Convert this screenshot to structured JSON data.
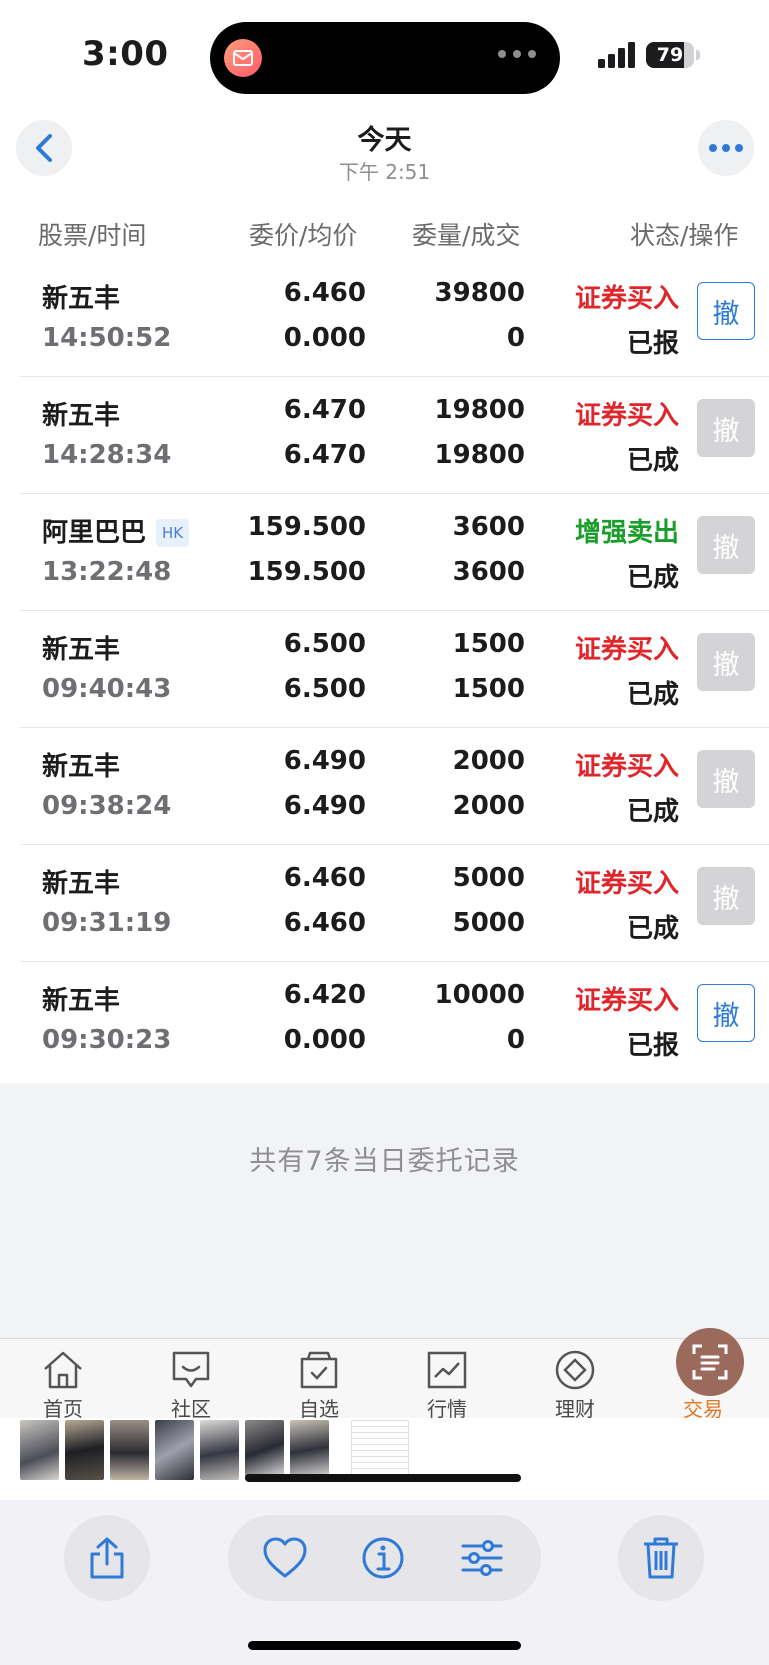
{
  "status_bar": {
    "time": "3:00",
    "battery": "79",
    "battery_level": 0.79
  },
  "nav": {
    "title": "今天",
    "subtitle": "下午 2:51",
    "back_icon": "chevron-left-icon",
    "more_icon": "ellipsis-icon"
  },
  "columns": {
    "stock_time": "股票/时间",
    "price_avg": "委价/均价",
    "qty_filled": "委量/成交",
    "status_action": "状态/操作"
  },
  "orders": [
    {
      "name": "新五丰",
      "tag": "",
      "time": "14:50:52",
      "price": "6.460",
      "avg": "0.000",
      "qty": "39800",
      "filled": "0",
      "action": "证券买入",
      "action_color": "red",
      "state": "已报",
      "cancel": "撤",
      "cancelable": true
    },
    {
      "name": "新五丰",
      "tag": "",
      "time": "14:28:34",
      "price": "6.470",
      "avg": "6.470",
      "qty": "19800",
      "filled": "19800",
      "action": "证券买入",
      "action_color": "red",
      "state": "已成",
      "cancel": "撤",
      "cancelable": false
    },
    {
      "name": "阿里巴巴",
      "tag": "HK",
      "time": "13:22:48",
      "price": "159.500",
      "avg": "159.500",
      "qty": "3600",
      "filled": "3600",
      "action": "增强卖出",
      "action_color": "green",
      "state": "已成",
      "cancel": "撤",
      "cancelable": false
    },
    {
      "name": "新五丰",
      "tag": "",
      "time": "09:40:43",
      "price": "6.500",
      "avg": "6.500",
      "qty": "1500",
      "filled": "1500",
      "action": "证券买入",
      "action_color": "red",
      "state": "已成",
      "cancel": "撤",
      "cancelable": false
    },
    {
      "name": "新五丰",
      "tag": "",
      "time": "09:38:24",
      "price": "6.490",
      "avg": "6.490",
      "qty": "2000",
      "filled": "2000",
      "action": "证券买入",
      "action_color": "red",
      "state": "已成",
      "cancel": "撤",
      "cancelable": false
    },
    {
      "name": "新五丰",
      "tag": "",
      "time": "09:31:19",
      "price": "6.460",
      "avg": "6.460",
      "qty": "5000",
      "filled": "5000",
      "action": "证券买入",
      "action_color": "red",
      "state": "已成",
      "cancel": "撤",
      "cancelable": false
    },
    {
      "name": "新五丰",
      "tag": "",
      "time": "09:30:23",
      "price": "6.420",
      "avg": "0.000",
      "qty": "10000",
      "filled": "0",
      "action": "证券买入",
      "action_color": "red",
      "state": "已报",
      "cancel": "撤",
      "cancelable": true
    }
  ],
  "summary": "共有7条当日委托记录",
  "tabs": [
    {
      "label": "首页",
      "icon": "home-icon"
    },
    {
      "label": "社区",
      "icon": "chat-icon"
    },
    {
      "label": "自选",
      "icon": "watchlist-icon"
    },
    {
      "label": "行情",
      "icon": "market-chart-icon"
    },
    {
      "label": "理财",
      "icon": "diamond-icon"
    },
    {
      "label": "交易",
      "icon": "scan-icon",
      "active": true
    }
  ],
  "toolbar": {
    "share_icon": "share-icon",
    "favorite_icon": "heart-icon",
    "info_icon": "info-icon",
    "adjust_icon": "sliders-icon",
    "delete_icon": "trash-icon"
  },
  "colors": {
    "red": "#e0262b",
    "green": "#1a9e2a",
    "blue": "#2f7ad6",
    "tab_active": "#e07a25"
  }
}
